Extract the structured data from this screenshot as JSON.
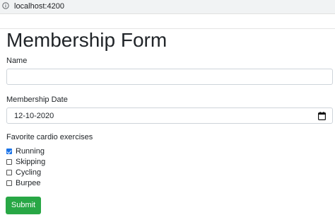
{
  "browser": {
    "url": "localhost:4200",
    "info_icon": "info-icon"
  },
  "form": {
    "title": "Membership Form",
    "name_label": "Name",
    "name_value": "",
    "date_label": "Membership Date",
    "date_value": "12-10-2020",
    "date_icon": "calendar-icon",
    "exercises_label": "Favorite cardio exercises",
    "exercises": [
      {
        "label": "Running",
        "checked": true
      },
      {
        "label": "Skipping",
        "checked": false
      },
      {
        "label": "Cycling",
        "checked": false
      },
      {
        "label": "Burpee",
        "checked": false
      }
    ],
    "submit_label": "Submit",
    "submit_color": "#28a745",
    "checkbox_checked_color": "#1a73e8"
  }
}
